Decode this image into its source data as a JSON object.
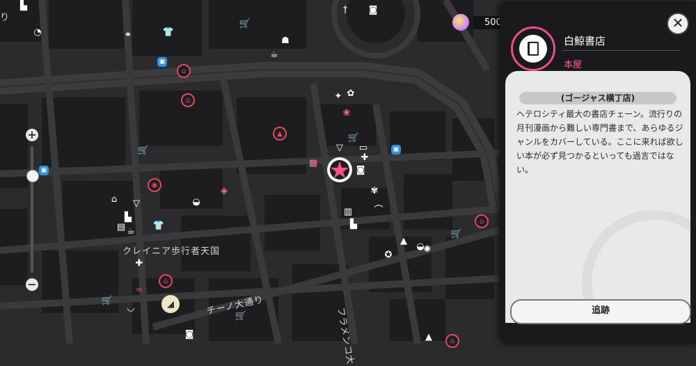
{
  "map": {
    "streets": [
      {
        "text": "クレイニア歩行者天国"
      },
      {
        "text": "チーノ大通り"
      },
      {
        "text": "フラメンコ大"
      }
    ],
    "edge_text": "り"
  },
  "zoom": {
    "plus": "+",
    "minus": "−"
  },
  "currency": {
    "value": "500"
  },
  "panel": {
    "close_label": "✕",
    "shop_name": "白鯨書店",
    "category": "本屋",
    "branch": "(ゴージャス横丁店)",
    "description": "ヘテロシティ最大の書店チェーン。流行りの月刊漫画から難しい専門書まで、あらゆるジャンルをカバーしている。ここに来れば欲しい本が必ず見つかるといっても過言ではない。",
    "track_button": "追跡",
    "icon": "book-icon",
    "accent": "#e8508a"
  }
}
